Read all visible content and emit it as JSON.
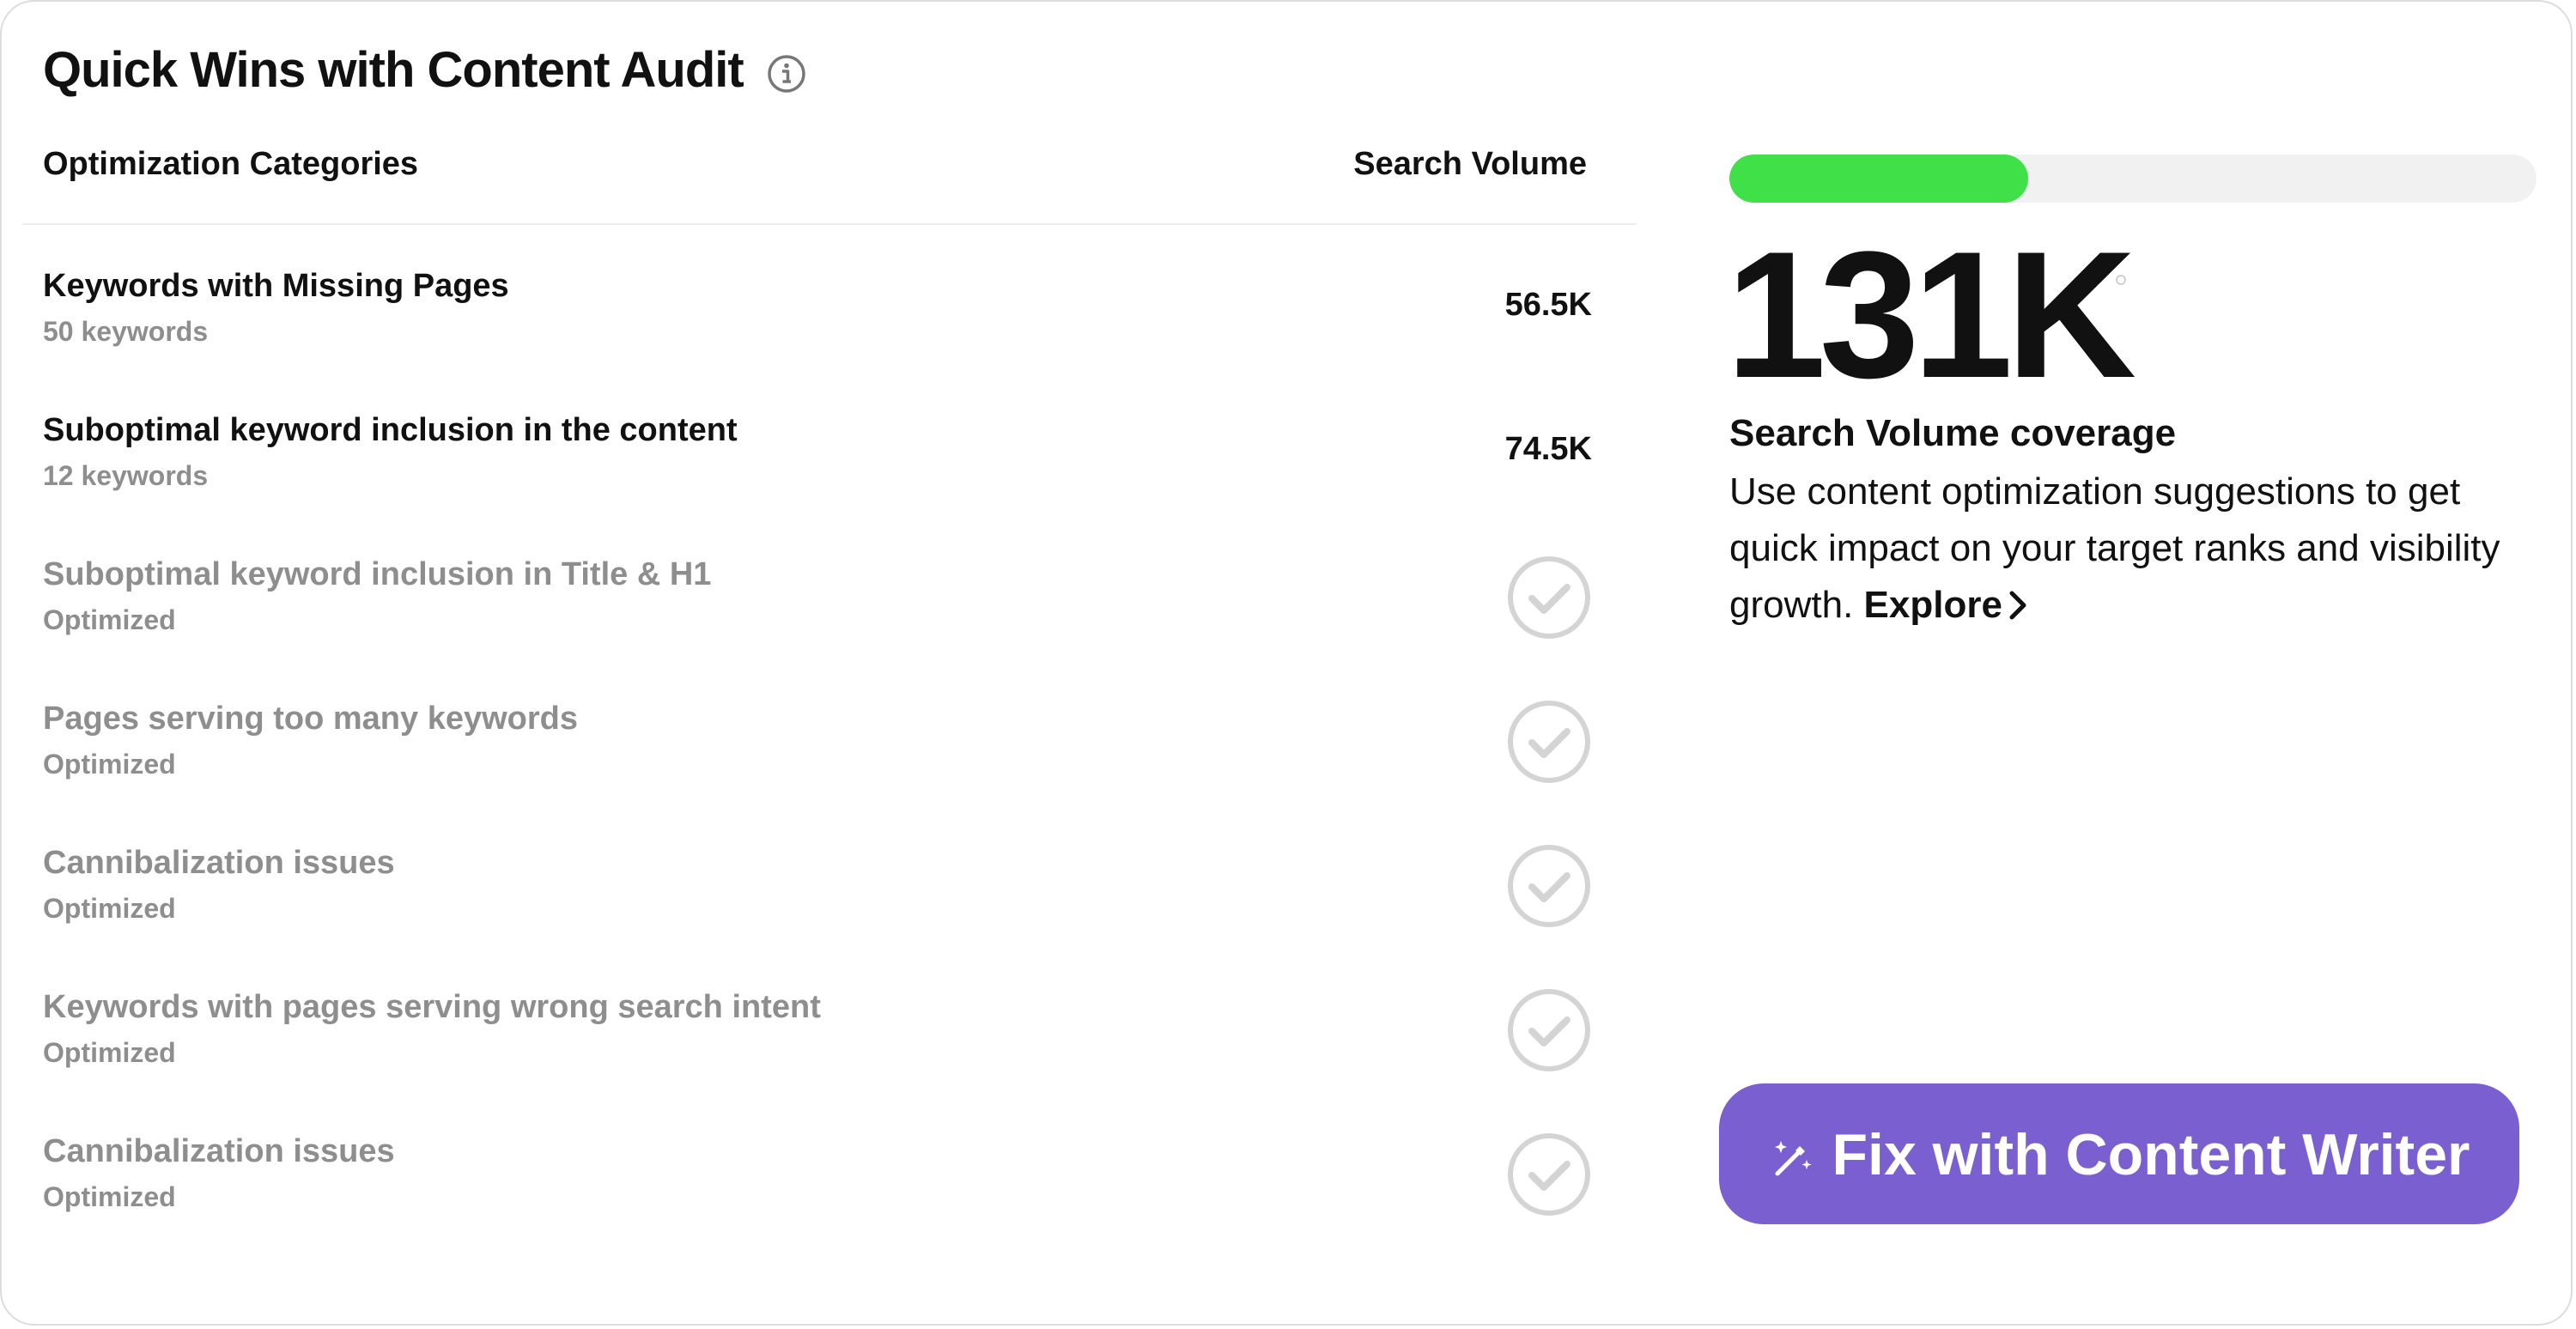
{
  "header": {
    "title": "Quick Wins with Content Audit",
    "info_icon": "info-icon"
  },
  "table": {
    "columns": {
      "category": "Optimization Categories",
      "volume": "Search Volume"
    },
    "rows": [
      {
        "title": "Keywords with Missing Pages",
        "subtitle": "50 keywords",
        "value": "56.5K",
        "optimized": false
      },
      {
        "title": "Suboptimal keyword inclusion in the content",
        "subtitle": "12 keywords",
        "value": "74.5K",
        "optimized": false
      },
      {
        "title": "Suboptimal keyword inclusion in Title & H1",
        "subtitle": "Optimized",
        "value": "",
        "optimized": true
      },
      {
        "title": "Pages serving too many keywords",
        "subtitle": "Optimized",
        "value": "",
        "optimized": true
      },
      {
        "title": "Cannibalization issues",
        "subtitle": "Optimized",
        "value": "",
        "optimized": true
      },
      {
        "title": "Keywords with pages serving wrong search intent",
        "subtitle": "Optimized",
        "value": "",
        "optimized": true
      },
      {
        "title": "Cannibalization issues",
        "subtitle": "Optimized",
        "value": "",
        "optimized": true
      }
    ]
  },
  "summary": {
    "progress_fraction": 0.37,
    "progress_color": "#3fe048",
    "big_number": "131K",
    "coverage_title": "Search Volume coverage",
    "coverage_desc": "Use content optimization suggestions to get quick impact on your target ranks and visibility growth.",
    "explore_label": "Explore",
    "explore_icon": "chevron-right-icon"
  },
  "cta": {
    "label": "Fix with Content Writer",
    "icon": "magic-wand-icon",
    "color": "#7a5fd0"
  },
  "colors": {
    "muted_text": "#8e8e8e",
    "check_gray": "#d4d4d4"
  }
}
